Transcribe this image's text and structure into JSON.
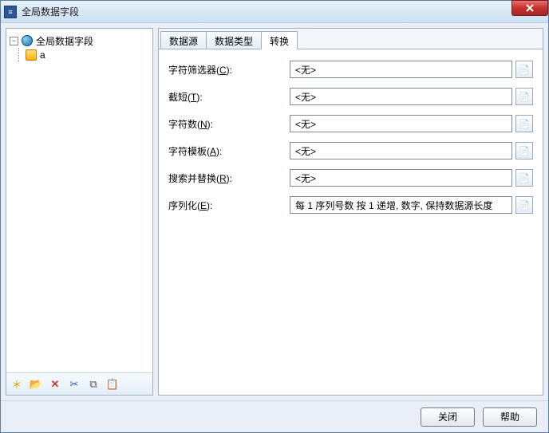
{
  "window": {
    "title": "全局数据字段"
  },
  "tree": {
    "root_label": "全局数据字段",
    "child_label": "a"
  },
  "toolbar": {
    "new_icon": "＊",
    "open_icon": "📂",
    "delete_icon": "✕",
    "cut_icon": "✂",
    "copy_icon": "⧉",
    "paste_icon": "📋"
  },
  "tabs": {
    "items": [
      {
        "label": "数据源"
      },
      {
        "label": "数据类型"
      },
      {
        "label": "转换"
      }
    ],
    "active_index": 2
  },
  "fields": {
    "char_filter": {
      "label_pre": "字符筛选器(",
      "accel": "C",
      "label_post": "):",
      "value": "<无>"
    },
    "truncate": {
      "label_pre": "截短(",
      "accel": "T",
      "label_post": "):",
      "value": "<无>"
    },
    "char_count": {
      "label_pre": "字符数(",
      "accel": "N",
      "label_post": "):",
      "value": "<无>"
    },
    "char_tpl": {
      "label_pre": "字符模板(",
      "accel": "A",
      "label_post": "):",
      "value": "<无>"
    },
    "search_rep": {
      "label_pre": "搜索并替换(",
      "accel": "R",
      "label_post": "):",
      "value": "<无>"
    },
    "serialize": {
      "label_pre": "序列化(",
      "accel": "E",
      "label_post": "):",
      "value": "每 1 序列号数 按 1 递增, 数字, 保持数据源长度"
    }
  },
  "footer": {
    "close_label": "关闭",
    "help_label": "帮助"
  },
  "icons": {
    "field_btn_glyph": "📄"
  }
}
